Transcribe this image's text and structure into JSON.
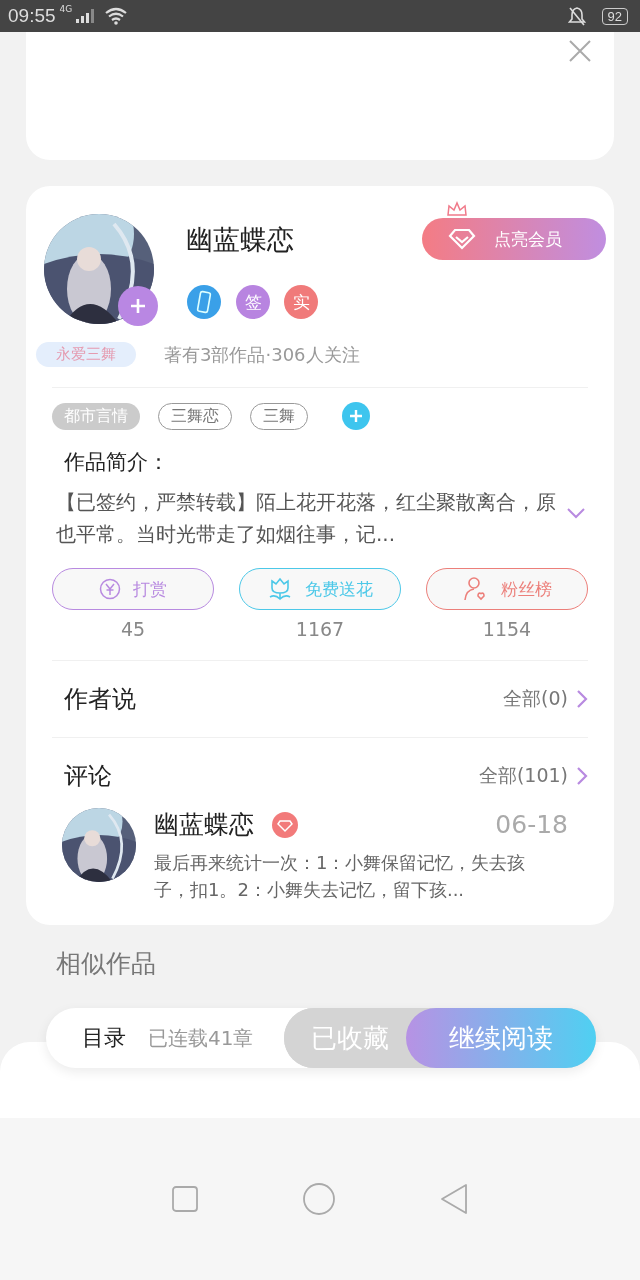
{
  "status_bar": {
    "time": "09:55",
    "network": "4G",
    "battery": "92"
  },
  "author": {
    "name": "幽蓝蝶恋",
    "vip_button": "点亮会员",
    "badges": [
      {
        "kind": "phone"
      },
      {
        "kind": "text",
        "text": "签",
        "color": "#b884e0"
      },
      {
        "kind": "text",
        "text": "实",
        "color": "#f07a7a"
      }
    ],
    "fan_tag": "永爱三舞",
    "stats": "著有3部作品·306人关注"
  },
  "tags": [
    {
      "label": "都市言情",
      "kind": "filled"
    },
    {
      "label": "三舞恋",
      "kind": "outline"
    },
    {
      "label": "三舞",
      "kind": "outline"
    }
  ],
  "synopsis": {
    "title": "作品简介：",
    "text": "【已签约，严禁转载】陌上花开花落，红尘聚散离合，原也平常。当时光带走了如烟往事，记..."
  },
  "actions": [
    {
      "kind": "reward",
      "label": "打赏",
      "count": "45",
      "color": "#b88ae0"
    },
    {
      "kind": "flower",
      "label": "免费送花",
      "count": "1167",
      "color": "#4cc8e8"
    },
    {
      "kind": "fans",
      "label": "粉丝榜",
      "count": "1154",
      "color": "#ec7f7a"
    }
  ],
  "author_says": {
    "title": "作者说",
    "link": "全部(0)"
  },
  "comments": {
    "title": "评论",
    "link": "全部(101)",
    "items": [
      {
        "user": "幽蓝蝶恋",
        "date": "06-18",
        "text": "最后再来统计一次：1：小舞保留记忆，失去孩子，扣1。2：小舞失去记忆，留下孩..."
      }
    ]
  },
  "similar_title": "相似作品",
  "bottom_bar": {
    "catalog": "目录",
    "chapters": "已连载41章",
    "collected": "已收藏",
    "continue": "继续阅读"
  }
}
